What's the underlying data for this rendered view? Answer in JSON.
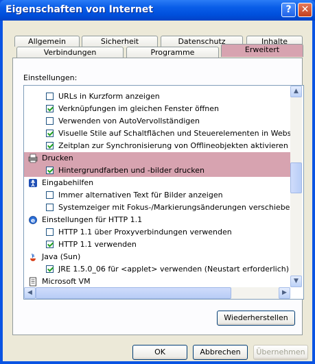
{
  "window": {
    "title": "Eigenschaften von Internet",
    "help_glyph": "?",
    "close_glyph": "✕"
  },
  "tabs_row1": [
    "Allgemein",
    "Sicherheit",
    "Datenschutz",
    "Inhalte"
  ],
  "tabs_row2": [
    "Verbindungen",
    "Programme",
    "Erweitert"
  ],
  "settings_label": "Einstellungen:",
  "tree_rows": [
    {
      "type": "checkbox",
      "checked": false,
      "text": "URLs in Kurzform anzeigen"
    },
    {
      "type": "checkbox",
      "checked": true,
      "text": "Verknüpfungen im gleichen Fenster öffnen"
    },
    {
      "type": "checkbox",
      "checked": false,
      "text": "Verwenden von AutoVervollständigen"
    },
    {
      "type": "checkbox",
      "checked": true,
      "text": "Visuelle Stile auf Schaltflächen und Steuerelementen in Webse"
    },
    {
      "type": "checkbox",
      "checked": true,
      "text": "Zeitplan zur Synchronisierung von Offlineobjekten aktivieren"
    },
    {
      "type": "category",
      "icon": "printer-icon",
      "text": "Drucken",
      "highlight": true
    },
    {
      "type": "checkbox",
      "checked": true,
      "text": "Hintergrundfarben und -bilder drucken",
      "highlight": true
    },
    {
      "type": "category",
      "icon": "accessibility-icon",
      "text": "Eingabehilfen"
    },
    {
      "type": "checkbox",
      "checked": false,
      "text": "Immer alternativen Text für Bilder anzeigen"
    },
    {
      "type": "checkbox",
      "checked": false,
      "text": "Systemzeiger mit Fokus-/Markierungsänderungen verschieben"
    },
    {
      "type": "category",
      "icon": "ie-icon",
      "text": "Einstellungen für HTTP 1.1"
    },
    {
      "type": "checkbox",
      "checked": false,
      "text": "HTTP 1.1 über Proxyverbindungen verwenden"
    },
    {
      "type": "checkbox",
      "checked": true,
      "text": "HTTP 1.1 verwenden"
    },
    {
      "type": "category",
      "icon": "java-icon",
      "text": "Java (Sun)"
    },
    {
      "type": "checkbox",
      "checked": true,
      "text": "JRE 1.5.0_06 für <applet> verwenden (Neustart erforderlich)"
    },
    {
      "type": "category",
      "icon": "document-icon",
      "text": "Microsoft VM"
    }
  ],
  "scroll": {
    "up": "▲",
    "down": "▼",
    "left": "◀",
    "right": "▶"
  },
  "buttons": {
    "restore": "Wiederherstellen",
    "ok": "OK",
    "cancel": "Abbrechen",
    "apply": "Übernehmen"
  },
  "colors": {
    "highlight": "#d7a3b0",
    "title_blue": "#0a54e3",
    "dialog": "#ece9d8"
  }
}
